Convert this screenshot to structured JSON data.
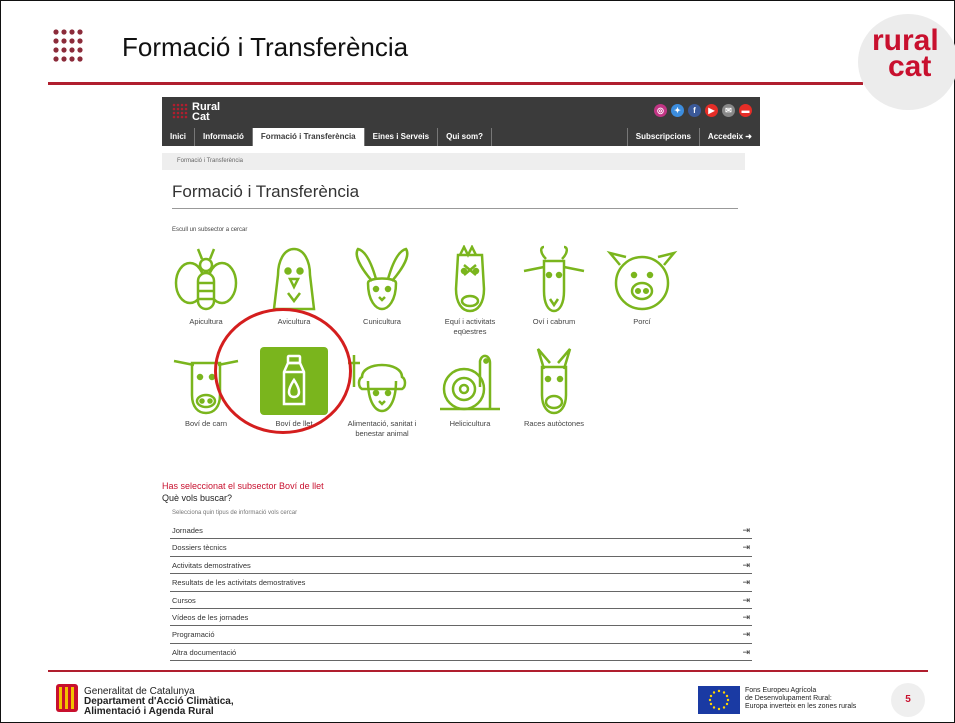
{
  "slide": {
    "title": "Formació i Transferència",
    "logo_line1": "rural",
    "logo_line2": "cat",
    "page_number": "5"
  },
  "site": {
    "logo_line1": "Rural",
    "logo_line2": "Cat",
    "nav": {
      "items": [
        "Inici",
        "Informació",
        "Formació i Transferència",
        "Eines i Serveis",
        "Qui som?"
      ],
      "active": "Formació i Transferència",
      "right_items": [
        "Subscripcions",
        "Accedeix"
      ]
    },
    "socials": [
      {
        "name": "instagram-icon",
        "glyph": "◎",
        "color": "#c13584"
      },
      {
        "name": "twitter-icon",
        "glyph": "✦",
        "color": "#3c8dde"
      },
      {
        "name": "facebook-icon",
        "glyph": "f",
        "color": "#3b5998"
      },
      {
        "name": "youtube-icon",
        "glyph": "▶",
        "color": "#e52d27"
      },
      {
        "name": "mail-icon",
        "glyph": "✉",
        "color": "#888888"
      },
      {
        "name": "print-icon",
        "glyph": "▬",
        "color": "#e52d27"
      }
    ],
    "breadcrumb": "Formació i Transferència",
    "page_heading": "Formació i Transferència",
    "choose_label": "Escull un subsector a cercar",
    "subsectors": [
      {
        "label": "Apicultura",
        "icon": "bee-icon"
      },
      {
        "label": "Avicultura",
        "icon": "hen-icon"
      },
      {
        "label": "Cunicultura",
        "icon": "rabbit-icon"
      },
      {
        "label": "Equí i activitats eqüestres",
        "icon": "horse-icon"
      },
      {
        "label": "Oví i cabrum",
        "icon": "goat-icon"
      },
      {
        "label": "Porcí",
        "icon": "pig-icon"
      },
      {
        "label": "Boví de carn",
        "icon": "cow-icon"
      },
      {
        "label": "Boví de llet",
        "icon": "milk-bottle-icon",
        "selected": true
      },
      {
        "label": "Alimentació, sanitat i benestar animal",
        "icon": "sheep-icon"
      },
      {
        "label": "Helicicultura",
        "icon": "snail-icon"
      },
      {
        "label": "Races autòctones",
        "icon": "donkey-icon"
      }
    ],
    "selected_message": "Has seleccionat el subsector Boví de llet",
    "question": "Què vols buscar?",
    "select_hint": "Selecciona quin tipus de informació vols cercar",
    "options": [
      "Jornades",
      "Dossiers tècnics",
      "Activitats demostratives",
      "Resultats de les activitats demostratives",
      "Cursos",
      "Vídeos de les jornades",
      "Programació",
      "Altra documentació"
    ],
    "accent_green": "#7ab51d"
  },
  "footer": {
    "gencat_line1": "Generalitat de Catalunya",
    "gencat_line2": "Departament d'Acció Climàtica,",
    "gencat_line3": "Alimentació i Agenda Rural",
    "fons_line1": "Fons Europeu Agrícola",
    "fons_line2": "de Desenvolupament Rural:",
    "fons_line3": "Europa inverteix en les zones rurals"
  }
}
